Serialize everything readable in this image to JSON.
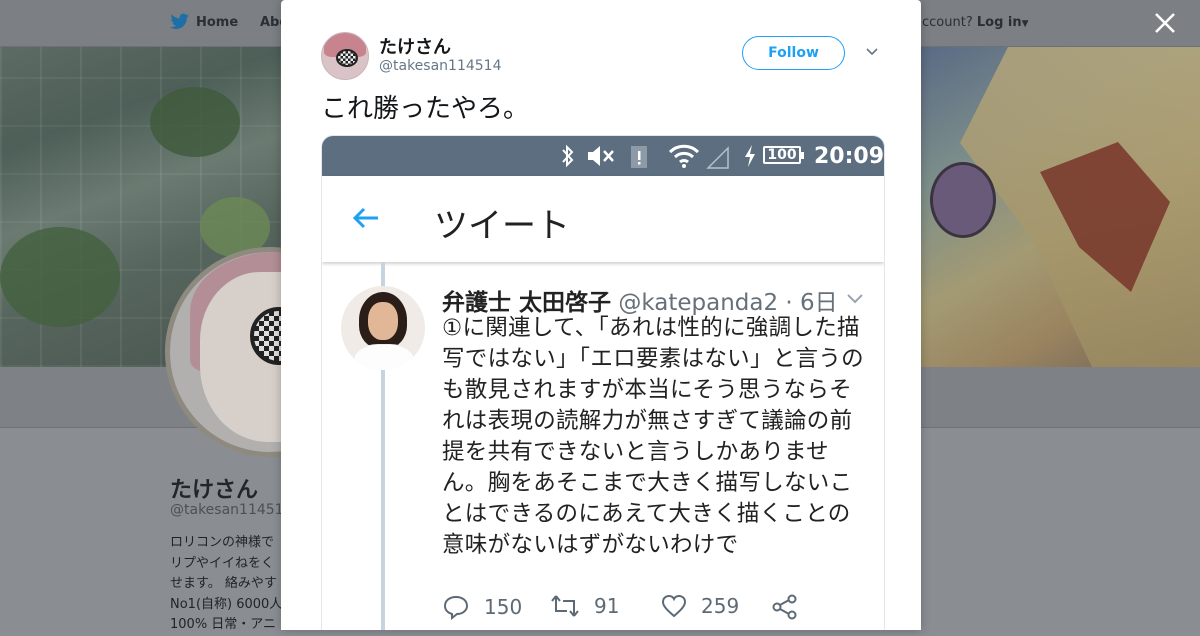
{
  "topnav": {
    "home_label": "Home",
    "about_label": "Abo",
    "account_prompt": "ccount?",
    "login_label": "Log in"
  },
  "sidebar": {
    "name": "たけさん",
    "handle": "@takesan11451",
    "bio": "ロリコンの神様で\nリプやイイねをく\nせます。 絡みやす\nNo1(自称) 6000人\n100% 日常・アニ"
  },
  "modal": {
    "author_name": "たけさん",
    "author_handle": "@takesan114514",
    "follow_label": "Follow",
    "tweet_text": "これ勝ったやろ。",
    "screenshot": {
      "status_time": "20:09",
      "battery": "100",
      "appbar_title": "ツイート",
      "quoted": {
        "name": "弁護士 太田啓子",
        "handle": "@katepanda2",
        "age": "· 6日",
        "text": "①に関連して、「あれは性的に強調した描写ではない」「エロ要素はない」と言うのも散見されますが本当にそう思うならそれは表現の読解力が無さすぎて議論の前提を共有できないと言うしかありません。胸をあそこまで大きく描写しないことはできるのにあえて大きく描くことの意味がないはずがないわけで",
        "replies": "150",
        "retweets": "91",
        "likes": "259"
      }
    }
  },
  "colors": {
    "twitter_blue": "#1da1f2",
    "status_bar": "#5c6e80"
  }
}
